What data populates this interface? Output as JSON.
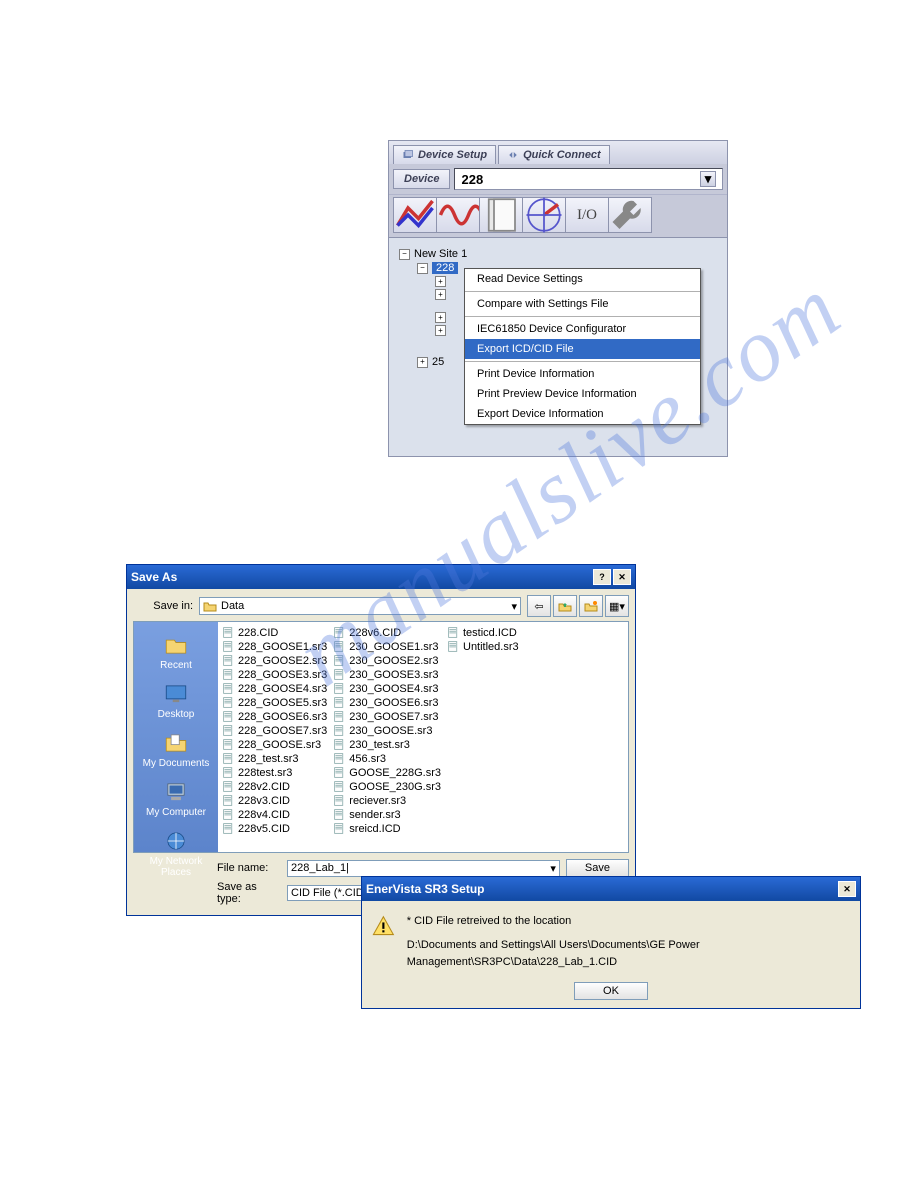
{
  "watermark": "manualslive.com",
  "panel1": {
    "tabs": {
      "t1": "Device Setup",
      "t2": "Quick Connect"
    },
    "device_label": "Device",
    "device_value": "228",
    "tool_buttons": [
      "chart1-icon",
      "chart2-icon",
      "doc-icon",
      "radar-icon",
      "io-icon",
      "wrench-icon"
    ],
    "io_text": "I/O",
    "tree": {
      "root": "New Site 1",
      "node_selected": "228",
      "last": "25"
    },
    "context_menu": {
      "items": [
        "Read Device Settings",
        "Compare with Settings File",
        "IEC61850 Device Configurator",
        "Export ICD/CID File",
        "Print Device Information",
        "Print Preview Device Information",
        "Export Device Information"
      ],
      "separators_after": [
        0,
        1,
        3
      ],
      "selected_index": 3
    }
  },
  "panel2": {
    "title": "Save As",
    "savein_label": "Save in:",
    "savein_value": "Data",
    "places": [
      "Recent",
      "Desktop",
      "My Documents",
      "My Computer",
      "My Network Places"
    ],
    "columns": [
      [
        "228.CID",
        "228_GOOSE1.sr3",
        "228_GOOSE2.sr3",
        "228_GOOSE3.sr3",
        "228_GOOSE4.sr3",
        "228_GOOSE5.sr3",
        "228_GOOSE6.sr3",
        "228_GOOSE7.sr3",
        "228_GOOSE.sr3",
        "228_test.sr3",
        "228test.sr3",
        "228v2.CID",
        "228v3.CID",
        "228v4.CID",
        "228v5.CID"
      ],
      [
        "228v6.CID",
        "230_GOOSE1.sr3",
        "230_GOOSE2.sr3",
        "230_GOOSE3.sr3",
        "230_GOOSE4.sr3",
        "230_GOOSE6.sr3",
        "230_GOOSE7.sr3",
        "230_GOOSE.sr3",
        "230_test.sr3",
        "456.sr3",
        "GOOSE_228G.sr3",
        "GOOSE_230G.sr3",
        "reciever.sr3",
        "sender.sr3",
        "sreicd.ICD"
      ],
      [
        "testicd.ICD",
        "Untitled.sr3"
      ]
    ],
    "filename_label": "File name:",
    "filename_value": "228_Lab_1|",
    "saveastype_label": "Save as type:",
    "saveastype_value": "CID File (*.CID",
    "btn_save": "Save"
  },
  "panel3": {
    "title": "EnerVista SR3 Setup",
    "line1": "* CID File retreived to the location",
    "line2": "D:\\Documents and Settings\\All Users\\Documents\\GE Power Management\\SR3PC\\Data\\228_Lab_1.CID",
    "btn_ok": "OK"
  }
}
